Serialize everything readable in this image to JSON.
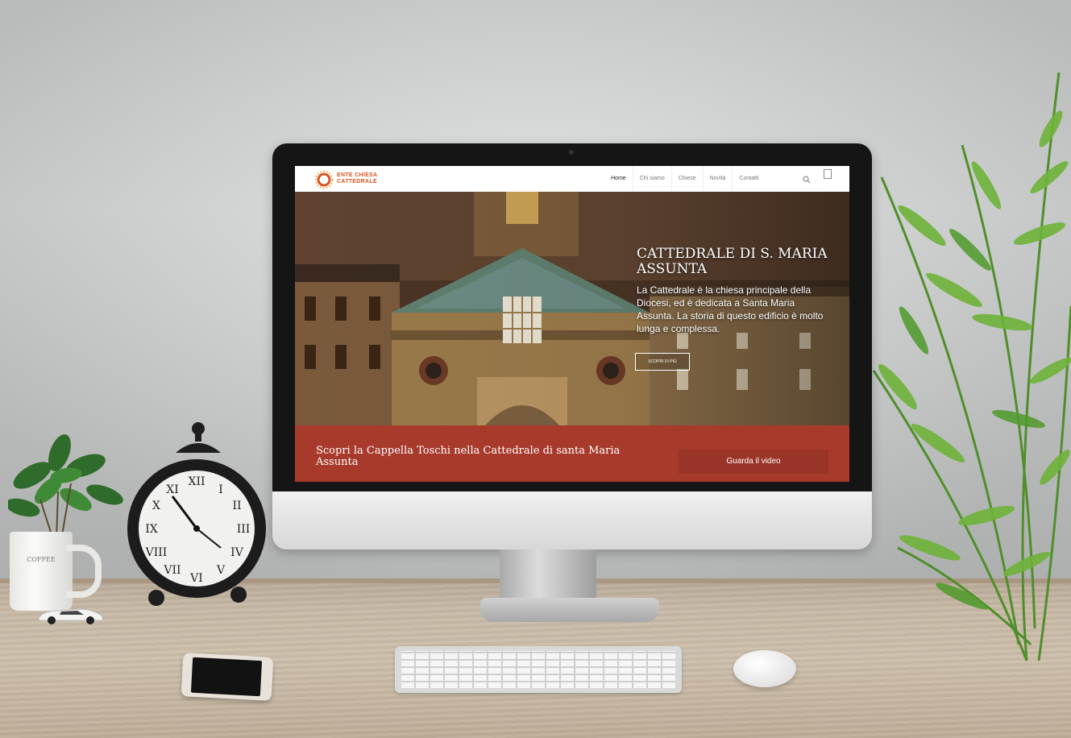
{
  "site": {
    "logo_text_line1": "ENTE CHIESA",
    "logo_text_line2": "CATTEDRALE",
    "nav": [
      "Home",
      "Chi siamo",
      "Chiese",
      "Novità",
      "Contatti"
    ],
    "active_nav": "Home"
  },
  "hero": {
    "title": "CATTEDRALE DI S. MARIA ASSUNTA",
    "text": "La Cattedrale è la chiesa principale della Diocesi, ed è dedicata a Santa Maria Assunta. La storia di questo edificio è molto lunga e complessa.",
    "button_label": "SCOPRI DI PIÙ"
  },
  "banner": {
    "text": "Scopri la Cappella Toschi nella Cattedrale di santa Maria Assunta",
    "button_label": "Guarda il video"
  },
  "colors": {
    "accent_orange": "#d6541f",
    "banner_red": "#a83a2c",
    "banner_button": "#9a3426"
  },
  "props": {
    "mug_text": "COFFEE"
  }
}
